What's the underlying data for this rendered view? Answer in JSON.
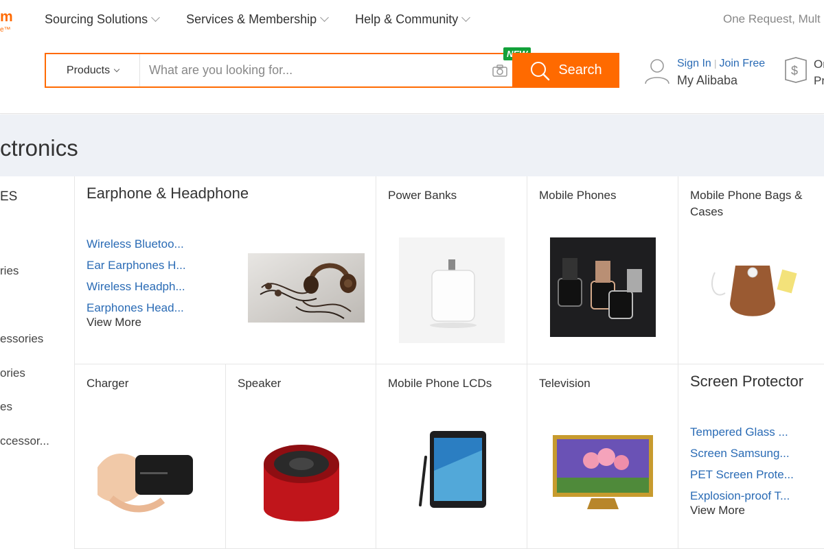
{
  "logo": {
    "main": "m",
    "sub": "e™"
  },
  "topnav": [
    {
      "label": "Sourcing Solutions"
    },
    {
      "label": "Services & Membership"
    },
    {
      "label": "Help & Community"
    }
  ],
  "one_request": "One Request, Mult",
  "search": {
    "category": "Products",
    "placeholder": "What are you looking for...",
    "button": "Search",
    "new_badge": "NEW"
  },
  "account": {
    "sign_in": "Sign In",
    "separator": "|",
    "join_free": "Join Free",
    "my_alibaba": "My Alibaba",
    "orders_line1": "Or",
    "orders_line2": "Pr"
  },
  "category_title": "ctronics",
  "sidebar": {
    "header": "ES",
    "items": [
      "ries",
      "essories",
      "ories",
      "es",
      "ccessor..."
    ]
  },
  "cards": {
    "earphone": {
      "title": "Earphone & Headphone",
      "links": [
        "Wireless Bluetoo...",
        "Ear Earphones H...",
        "Wireless Headph...",
        "Earphones Head..."
      ],
      "view_more": "View More"
    },
    "power_banks": {
      "title": "Power Banks"
    },
    "mobile_phones": {
      "title": "Mobile Phones"
    },
    "bags": {
      "title": "Mobile Phone Bags & Cases"
    },
    "charger": {
      "title": "Charger"
    },
    "speaker": {
      "title": "Speaker"
    },
    "lcds": {
      "title": "Mobile Phone LCDs"
    },
    "television": {
      "title": "Television"
    },
    "screen_protector": {
      "title": "Screen Protector",
      "links": [
        "Tempered Glass ...",
        "Screen Samsung...",
        "PET Screen Prote...",
        "Explosion-proof T..."
      ],
      "view_more": "View More"
    }
  },
  "colors": {
    "accent": "#ff6a00",
    "link": "#2a6bb5",
    "badge": "#12a13a",
    "band": "#eef1f6"
  },
  "icons": [
    "camera-icon",
    "search-icon",
    "user-icon",
    "order-protection-icon",
    "chevron-down-icon"
  ]
}
